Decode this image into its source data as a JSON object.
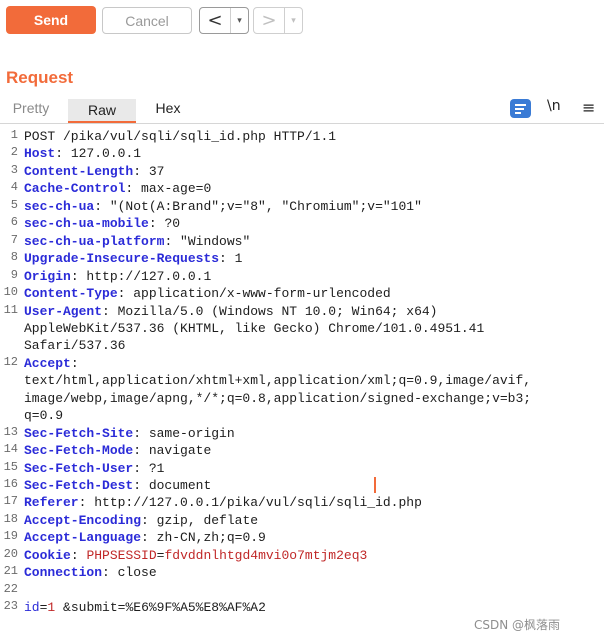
{
  "toolbar": {
    "send_label": "Send",
    "cancel_label": "Cancel",
    "prev_arrow": "<",
    "prev_drop": "▾",
    "next_arrow": ">",
    "next_drop": "▾"
  },
  "panel": {
    "title": "Request",
    "tabs": [
      {
        "label": "Pretty",
        "active": false
      },
      {
        "label": "Raw",
        "active": true
      },
      {
        "label": "Hex",
        "active": false
      }
    ],
    "icons": {
      "pretty_print": "pretty-print-icon",
      "newline": "\\n",
      "menu": "≡"
    }
  },
  "editor": {
    "lines": [
      {
        "n": "1",
        "text": "POST /pika/vul/sqli/sqli_id.php HTTP/1.1"
      },
      {
        "n": "2",
        "key": "Host",
        "value": " 127.0.0.1"
      },
      {
        "n": "3",
        "key": "Content-Length",
        "value": " 37"
      },
      {
        "n": "4",
        "key": "Cache-Control",
        "value": " max-age=0"
      },
      {
        "n": "5",
        "key": "sec-ch-ua",
        "value": " \"(Not(A:Brand\";v=\"8\", \"Chromium\";v=\"101\""
      },
      {
        "n": "6",
        "key": "sec-ch-ua-mobile",
        "value": " ?0"
      },
      {
        "n": "7",
        "key": "sec-ch-ua-platform",
        "value": " \"Windows\""
      },
      {
        "n": "8",
        "key": "Upgrade-Insecure-Requests",
        "value": " 1"
      },
      {
        "n": "9",
        "key": "Origin",
        "value": " http://127.0.0.1"
      },
      {
        "n": "10",
        "key": "Content-Type",
        "value": " application/x-www-form-urlencoded"
      },
      {
        "n": "11",
        "key": "User-Agent",
        "value": " Mozilla/5.0 (Windows NT 10.0; Win64; x64)"
      },
      {
        "n": "",
        "text": "AppleWebKit/537.36 (KHTML, like Gecko) Chrome/101.0.4951.41"
      },
      {
        "n": "",
        "text": "Safari/537.36"
      },
      {
        "n": "12",
        "key": "Accept",
        "value": ""
      },
      {
        "n": "",
        "text": "text/html,application/xhtml+xml,application/xml;q=0.9,image/avif,"
      },
      {
        "n": "",
        "text": "image/webp,image/apng,*/*;q=0.8,application/signed-exchange;v=b3;"
      },
      {
        "n": "",
        "text": "q=0.9"
      },
      {
        "n": "13",
        "key": "Sec-Fetch-Site",
        "value": " same-origin"
      },
      {
        "n": "14",
        "key": "Sec-Fetch-Mode",
        "value": " navigate"
      },
      {
        "n": "15",
        "key": "Sec-Fetch-User",
        "value": " ?1"
      },
      {
        "n": "16",
        "key": "Sec-Fetch-Dest",
        "value": " document"
      },
      {
        "n": "17",
        "key": "Referer",
        "value": " http://127.0.0.1/pika/vul/sqli/sqli_id.php"
      },
      {
        "n": "18",
        "key": "Accept-Encoding",
        "value": " gzip, deflate"
      },
      {
        "n": "19",
        "key": "Accept-Language",
        "value": " zh-CN,zh;q=0.9"
      },
      {
        "n": "20",
        "key": "Cookie",
        "cookie_name": "PHPSESSID",
        "cookie_val": "fdvddnlhtgd4mvi0o7mtjm2eq3"
      },
      {
        "n": "21",
        "key": "Connection",
        "value": " close"
      },
      {
        "n": "22",
        "text": ""
      },
      {
        "n": "23",
        "body": {
          "k1": "id",
          "v1": "1",
          "k2": "&submit",
          "v2": "%E6%9F%A5%E8%AF%A2"
        }
      }
    ]
  },
  "watermark": "CSDN @枫落雨",
  "colors": {
    "accent": "#f26b3a",
    "header_key": "#2b2bd8",
    "value_red": "#c02828"
  }
}
